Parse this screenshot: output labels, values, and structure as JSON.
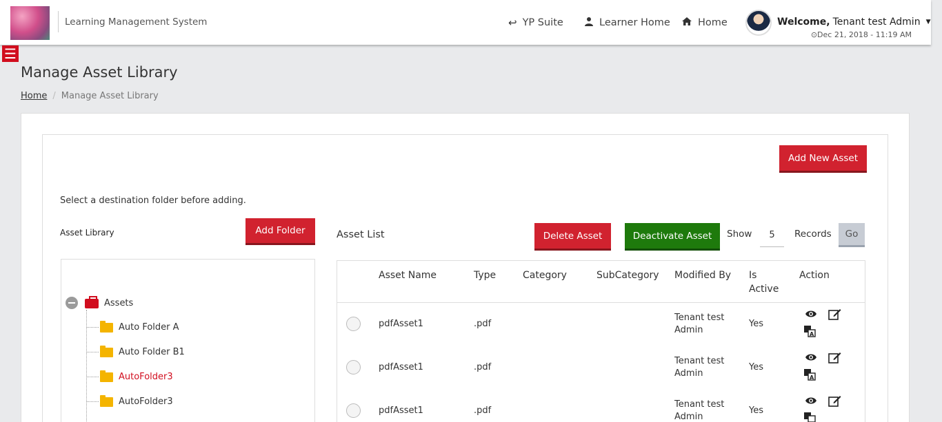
{
  "header": {
    "app_title": "Learning Management System",
    "nav": [
      {
        "label": "YP Suite",
        "icon": "return-arrow-icon"
      },
      {
        "label": "Learner Home",
        "icon": "user-icon"
      },
      {
        "label": "Home",
        "icon": "home-icon"
      }
    ],
    "welcome_prefix": "Welcome,",
    "user_name": "Tenant test Admin",
    "date": "Dec 21, 2018 - 11:19 AM"
  },
  "page": {
    "title": "Manage Asset Library",
    "breadcrumb": {
      "home": "Home",
      "current": "Manage Asset Library"
    }
  },
  "buttons": {
    "add_new_asset": "Add New Asset",
    "add_folder": "Add Folder",
    "delete_asset": "Delete Asset",
    "deactivate_asset": "Deactivate Asset",
    "go": "Go"
  },
  "hint": "Select a destination folder before adding.",
  "library": {
    "label": "Asset Library",
    "root": "Assets",
    "folders": [
      {
        "name": "Auto Folder A",
        "active": false
      },
      {
        "name": "Auto Folder B1",
        "active": false
      },
      {
        "name": "AutoFolder3",
        "active": true
      },
      {
        "name": "AutoFolder3",
        "active": false
      }
    ]
  },
  "asset_list": {
    "title": "Asset List",
    "show_label": "Show",
    "records_value": "5",
    "records_label": "Records",
    "columns": [
      "Asset Name",
      "Type",
      "Category",
      "SubCategory",
      "Modified By",
      "Is Active",
      "Action"
    ],
    "is_active_line1": "Is",
    "is_active_line2": "Active",
    "rows": [
      {
        "name": "pdfAsset1",
        "type": ".pdf",
        "category": "",
        "subcategory": "",
        "modified_by_1": "Tenant test",
        "modified_by_2": "Admin",
        "active": "Yes"
      },
      {
        "name": "pdfAsset1",
        "type": ".pdf",
        "category": "",
        "subcategory": "",
        "modified_by_1": "Tenant test",
        "modified_by_2": "Admin",
        "active": "Yes"
      },
      {
        "name": "pdfAsset1",
        "type": ".pdf",
        "category": "",
        "subcategory": "",
        "modified_by_1": "Tenant test",
        "modified_by_2": "Admin",
        "active": "Yes"
      }
    ]
  },
  "colors": {
    "brand_red": "#d1222f",
    "green": "#1e7a0c",
    "active_folder": "#d10d1e"
  }
}
